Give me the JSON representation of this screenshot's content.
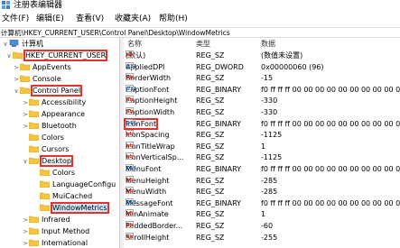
{
  "window": {
    "title": "注册表编辑器"
  },
  "menu": [
    "文件(F)",
    "编辑(E)",
    "查看(V)",
    "收藏夹(A)",
    "帮助(H)"
  ],
  "address": "计算机\\HKEY_CURRENT_USER\\Control Panel\\Desktop\\WindowMetrics",
  "tree": [
    {
      "label": "计算机",
      "exp": "∨",
      "level": 0,
      "highlight": false,
      "selected": false
    },
    {
      "label": "HKEY_CURRENT_USER",
      "exp": "∨",
      "level": 1,
      "highlight": true,
      "selected": false
    },
    {
      "label": "AppEvents",
      "exp": ">",
      "level": 2,
      "highlight": false,
      "selected": false
    },
    {
      "label": "Console",
      "exp": ">",
      "level": 2,
      "highlight": false,
      "selected": false
    },
    {
      "label": "Control Panel",
      "exp": "∨",
      "level": 2,
      "highlight": true,
      "selected": false
    },
    {
      "label": "Accessibility",
      "exp": ">",
      "level": 3,
      "highlight": false,
      "selected": false
    },
    {
      "label": "Appearance",
      "exp": ">",
      "level": 3,
      "highlight": false,
      "selected": false
    },
    {
      "label": "Bluetooth",
      "exp": ">",
      "level": 3,
      "highlight": false,
      "selected": false
    },
    {
      "label": "Colors",
      "exp": "",
      "level": 3,
      "highlight": false,
      "selected": false
    },
    {
      "label": "Cursors",
      "exp": "",
      "level": 3,
      "highlight": false,
      "selected": false
    },
    {
      "label": "Desktop",
      "exp": "∨",
      "level": 3,
      "highlight": true,
      "selected": false
    },
    {
      "label": "Colors",
      "exp": "",
      "level": 4,
      "highlight": false,
      "selected": false
    },
    {
      "label": "LanguageConfigu",
      "exp": "",
      "level": 4,
      "highlight": false,
      "selected": false
    },
    {
      "label": "MuiCached",
      "exp": "",
      "level": 4,
      "highlight": false,
      "selected": false
    },
    {
      "label": "WindowMetrics",
      "exp": "",
      "level": 4,
      "highlight": true,
      "selected": true
    },
    {
      "label": "Infrared",
      "exp": ">",
      "level": 3,
      "highlight": false,
      "selected": false
    },
    {
      "label": "Input Method",
      "exp": ">",
      "level": 3,
      "highlight": false,
      "selected": false
    },
    {
      "label": "International",
      "exp": ">",
      "level": 3,
      "highlight": false,
      "selected": false
    }
  ],
  "columns": {
    "name": "名称",
    "type": "类型",
    "data": "数据"
  },
  "values": [
    {
      "name": "(默认)",
      "type": "REG_SZ",
      "data": "(数值未设置)",
      "kind": "sz",
      "highlight": false
    },
    {
      "name": "AppliedDPI",
      "type": "REG_DWORD",
      "data": "0x00000060 (96)",
      "kind": "bin",
      "highlight": false
    },
    {
      "name": "BorderWidth",
      "type": "REG_SZ",
      "data": "-15",
      "kind": "sz",
      "highlight": false
    },
    {
      "name": "CaptionFont",
      "type": "REG_BINARY",
      "data": "f0 ff ff ff 00 00 00 00 00 00 00 00 00 00",
      "kind": "bin",
      "highlight": false
    },
    {
      "name": "CaptionHeight",
      "type": "REG_SZ",
      "data": "-330",
      "kind": "sz",
      "highlight": false
    },
    {
      "name": "CaptionWidth",
      "type": "REG_SZ",
      "data": "-330",
      "kind": "sz",
      "highlight": false
    },
    {
      "name": "IconFont",
      "type": "REG_BINARY",
      "data": "f0 ff ff ff 00 00 00 00 00 00 00 00 00 00",
      "kind": "bin",
      "highlight": true
    },
    {
      "name": "IconSpacing",
      "type": "REG_SZ",
      "data": "-1125",
      "kind": "sz",
      "highlight": false
    },
    {
      "name": "IconTitleWrap",
      "type": "REG_SZ",
      "data": "1",
      "kind": "sz",
      "highlight": false
    },
    {
      "name": "IconVerticalSp...",
      "type": "REG_SZ",
      "data": "-1125",
      "kind": "sz",
      "highlight": false
    },
    {
      "name": "MenuFont",
      "type": "REG_BINARY",
      "data": "f0 ff ff ff 00 00 00 00 00 00 00 00 00 00",
      "kind": "bin",
      "highlight": false
    },
    {
      "name": "MenuHeight",
      "type": "REG_SZ",
      "data": "-285",
      "kind": "sz",
      "highlight": false
    },
    {
      "name": "MenuWidth",
      "type": "REG_SZ",
      "data": "-285",
      "kind": "sz",
      "highlight": false
    },
    {
      "name": "MessageFont",
      "type": "REG_BINARY",
      "data": "f0 ff ff ff 00 00 00 00 00 00 00 00 00 00",
      "kind": "bin",
      "highlight": false
    },
    {
      "name": "MinAnimate",
      "type": "REG_SZ",
      "data": "1",
      "kind": "sz",
      "highlight": false
    },
    {
      "name": "PaddedBorder...",
      "type": "REG_SZ",
      "data": "-60",
      "kind": "sz",
      "highlight": false
    },
    {
      "name": "ScrollHeight",
      "type": "REG_SZ",
      "data": "-255",
      "kind": "sz",
      "highlight": false
    }
  ],
  "colors": {
    "highlight": "#e5322d",
    "folder": "#f5c542",
    "selection": "#cce8ff"
  }
}
